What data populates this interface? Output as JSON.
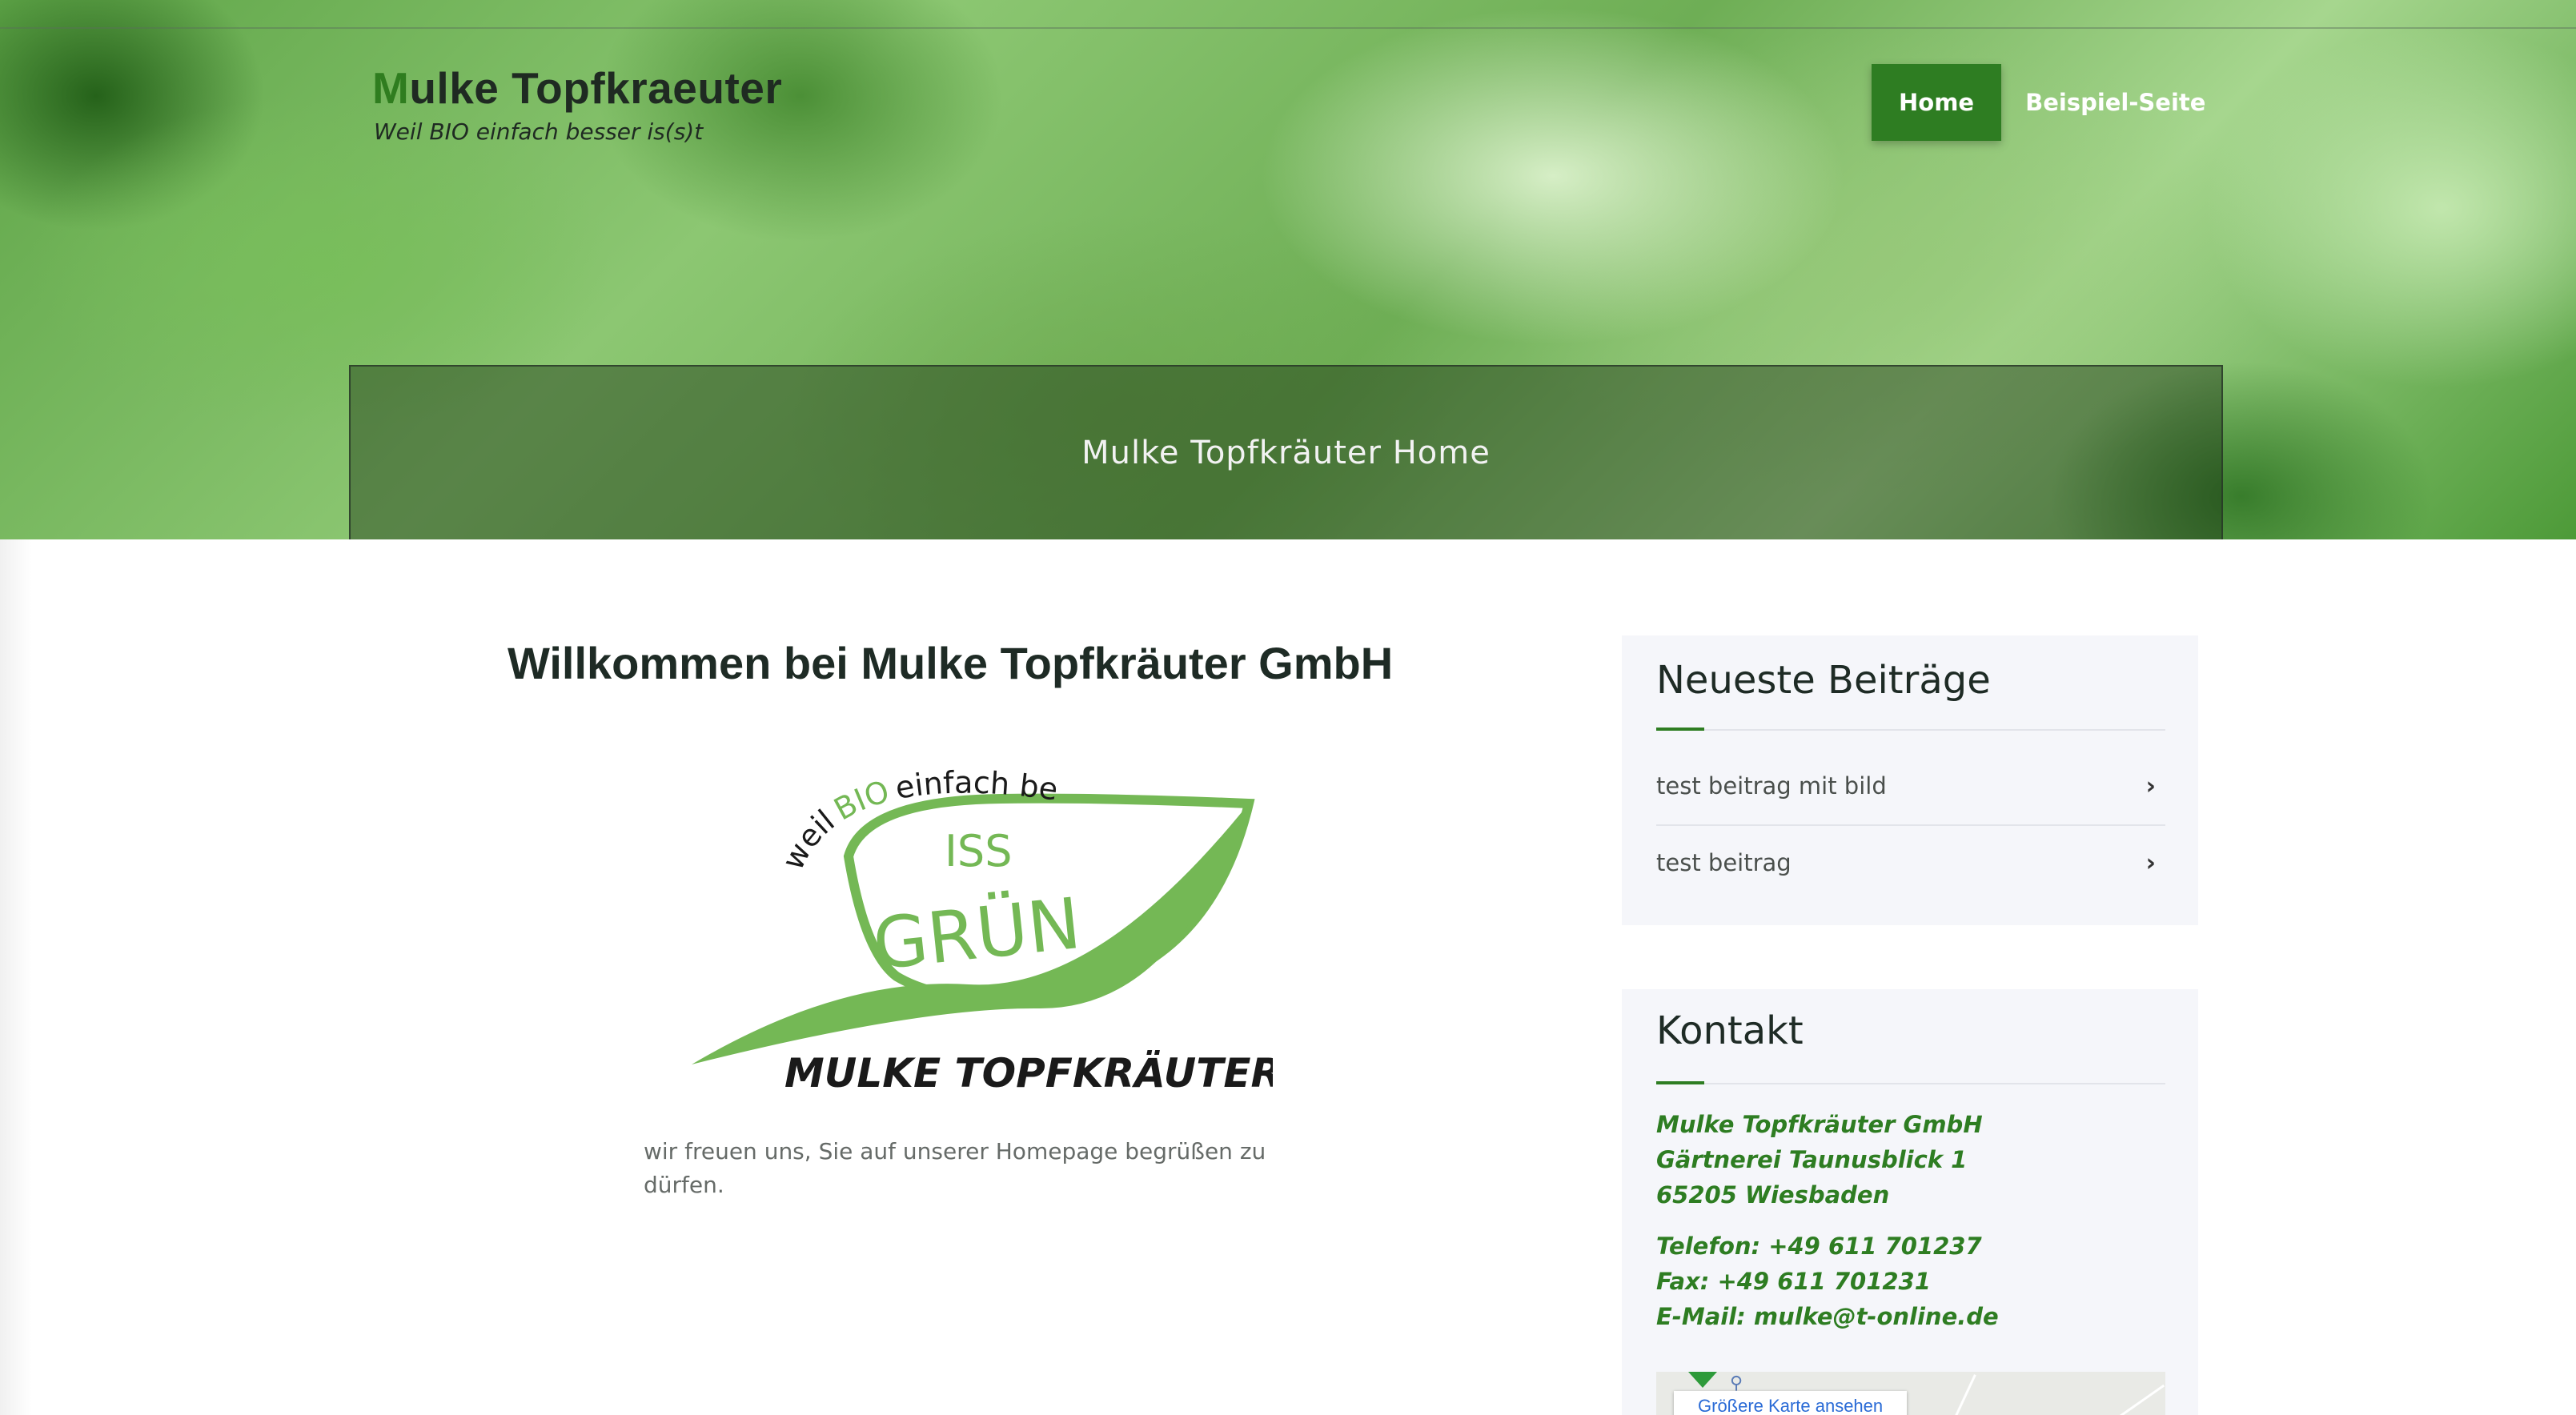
{
  "header": {
    "brand_first_letter": "M",
    "brand_rest": "ulke Topfkraeuter",
    "tagline": "Weil BIO einfach besser is(s)t",
    "nav": [
      {
        "label": "Home",
        "active": true
      },
      {
        "label": "Beispiel-Seite",
        "active": false
      }
    ],
    "banner_title": "Mulke Topfkräuter Home"
  },
  "main": {
    "title": "Willkommen bei Mulke Topfkräuter GmbH",
    "logo": {
      "arc_text_1": "weil",
      "arc_text_2": "BIO",
      "arc_text_3": "einfach besser is(s)t",
      "line1": "ISS",
      "line2": "GRÜN",
      "brand": "MULKE TOPFKRÄUTER"
    },
    "intro": "wir freuen uns, Sie auf unserer Homepage begrüßen zu dürfen."
  },
  "sidebar": {
    "recent_posts": {
      "title": "Neueste Beiträge",
      "items": [
        {
          "label": "test beitrag mit bild"
        },
        {
          "label": "test beitrag"
        }
      ]
    },
    "contact": {
      "title": "Kontakt",
      "company": "Mulke Topfkräuter GmbH",
      "street": "Gärtnerei Taunusblick 1",
      "city": "65205 Wiesbaden",
      "phone": "Telefon: +49 611 701237",
      "fax": "Fax: +49 611 701231",
      "email": "E-Mail: mulke@t-online.de",
      "map_link": "Größere Karte ansehen"
    }
  },
  "colors": {
    "accent": "#2e7d22",
    "logo_green": "#74b855",
    "text_dark": "#1e2b25"
  }
}
